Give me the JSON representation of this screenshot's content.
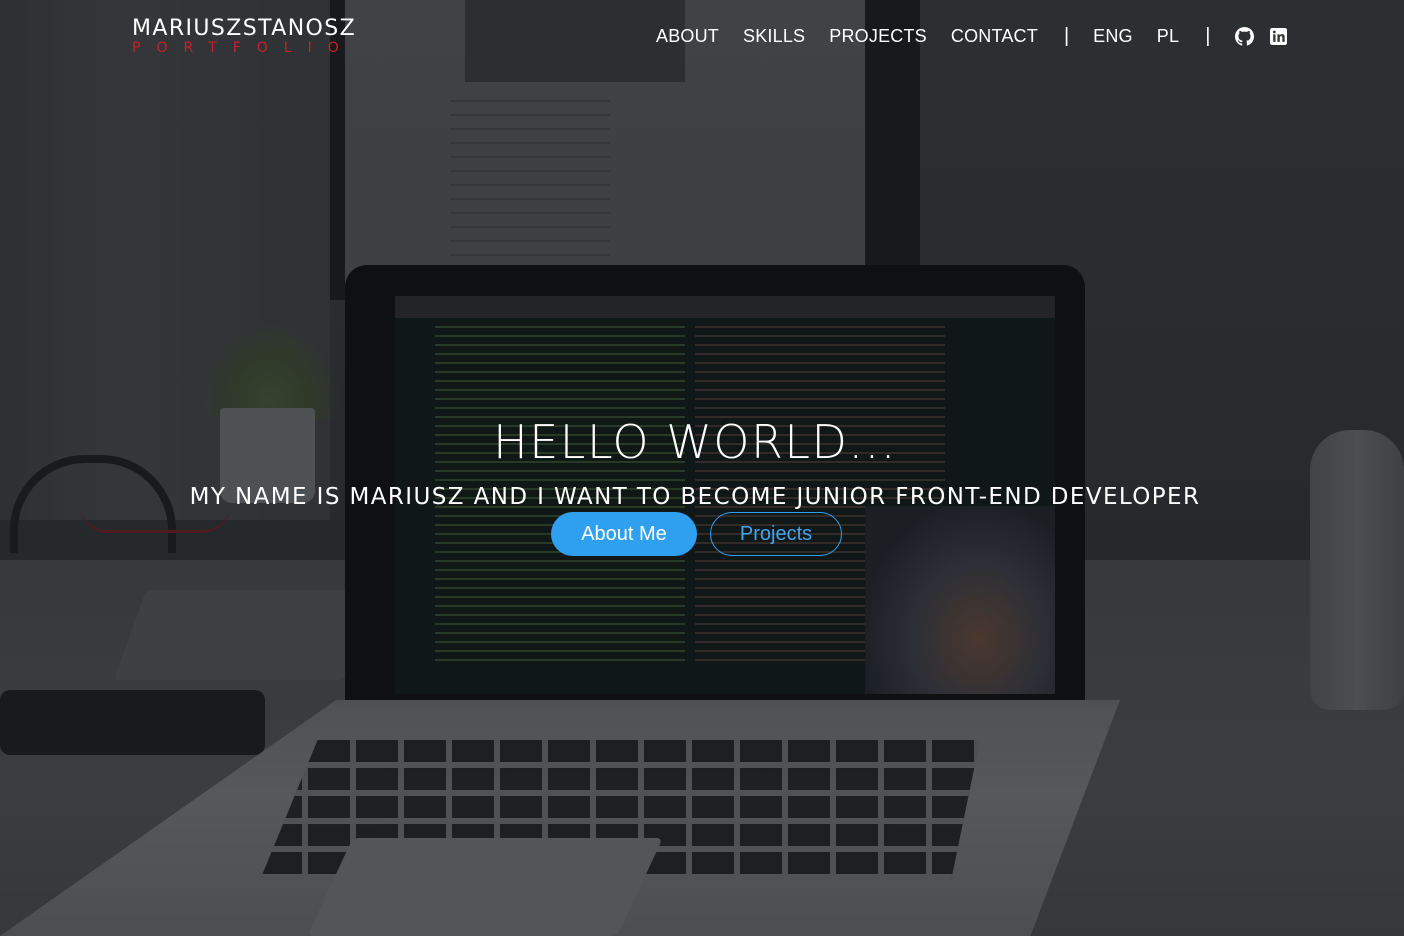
{
  "logo": {
    "name": "MARIUSZSTANOSZ",
    "subtitle": "PORTFOLIO",
    "subtitle_color": "#c4232b"
  },
  "nav": {
    "items": [
      {
        "label": "ABOUT"
      },
      {
        "label": "SKILLS"
      },
      {
        "label": "PROJECTS"
      },
      {
        "label": "CONTACT"
      }
    ],
    "separator": "|",
    "languages": [
      {
        "label": "ENG"
      },
      {
        "label": "PL"
      }
    ],
    "icons": [
      "github-icon",
      "linkedin-icon"
    ]
  },
  "hero": {
    "title": "HELLO WORLD...",
    "subtitle": "MY NAME IS MARIUSZ AND I WANT TO BECOME JUNIOR FRONT-END DEVELOPER",
    "primary_button": "About Me",
    "secondary_button": "Projects",
    "accent_color": "#2f9ff0"
  }
}
